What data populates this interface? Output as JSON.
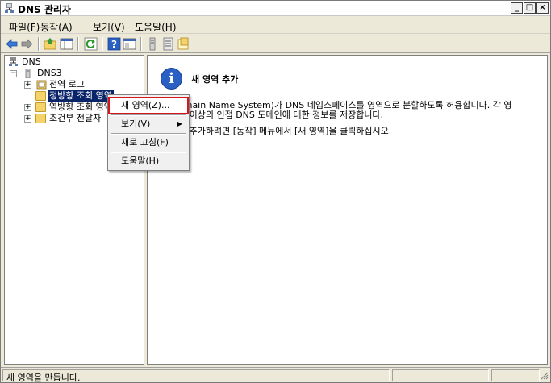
{
  "window": {
    "title": "DNS 관리자"
  },
  "menubar": [
    {
      "label": "파일(F)"
    },
    {
      "label": "동작(A)"
    },
    {
      "label": "보기(V)"
    },
    {
      "label": "도움말(H)"
    }
  ],
  "toolbar": {
    "icons": [
      "back-arrow-icon",
      "forward-arrow-icon",
      "up-folder-icon",
      "show-hide-tree-icon",
      "refresh-icon",
      "help-icon",
      "properties-icon",
      "server-icon",
      "server-list-icon",
      "zone-icon"
    ]
  },
  "tree": {
    "root": "DNS",
    "server": "DNS3",
    "items": [
      {
        "label": "전역 로그"
      },
      {
        "label": "정방향 조회 영역"
      },
      {
        "label": "역방향 조회 영역"
      },
      {
        "label": "조건부 전달자"
      }
    ]
  },
  "content": {
    "heading": "새 영역 추가",
    "line1": "omain Name System)가 DNS 네임스페이스를 영역으로 분할하도록 허용합니다. 각 영",
    "line2": "나 이상의 인접 DNS 도메인에 대한 정보를 저장합니다.",
    "line3": "을 추가하려면 [동작] 메뉴에서 [새 영역]을 클릭하십시오."
  },
  "context_menu": {
    "items": [
      {
        "label": "새 영역(Z)..."
      },
      {
        "label": "보기(V)"
      },
      {
        "label": "새로 고침(F)"
      },
      {
        "label": "도움말(H)"
      }
    ]
  },
  "status": {
    "text": "새 영역을 만듭니다."
  }
}
